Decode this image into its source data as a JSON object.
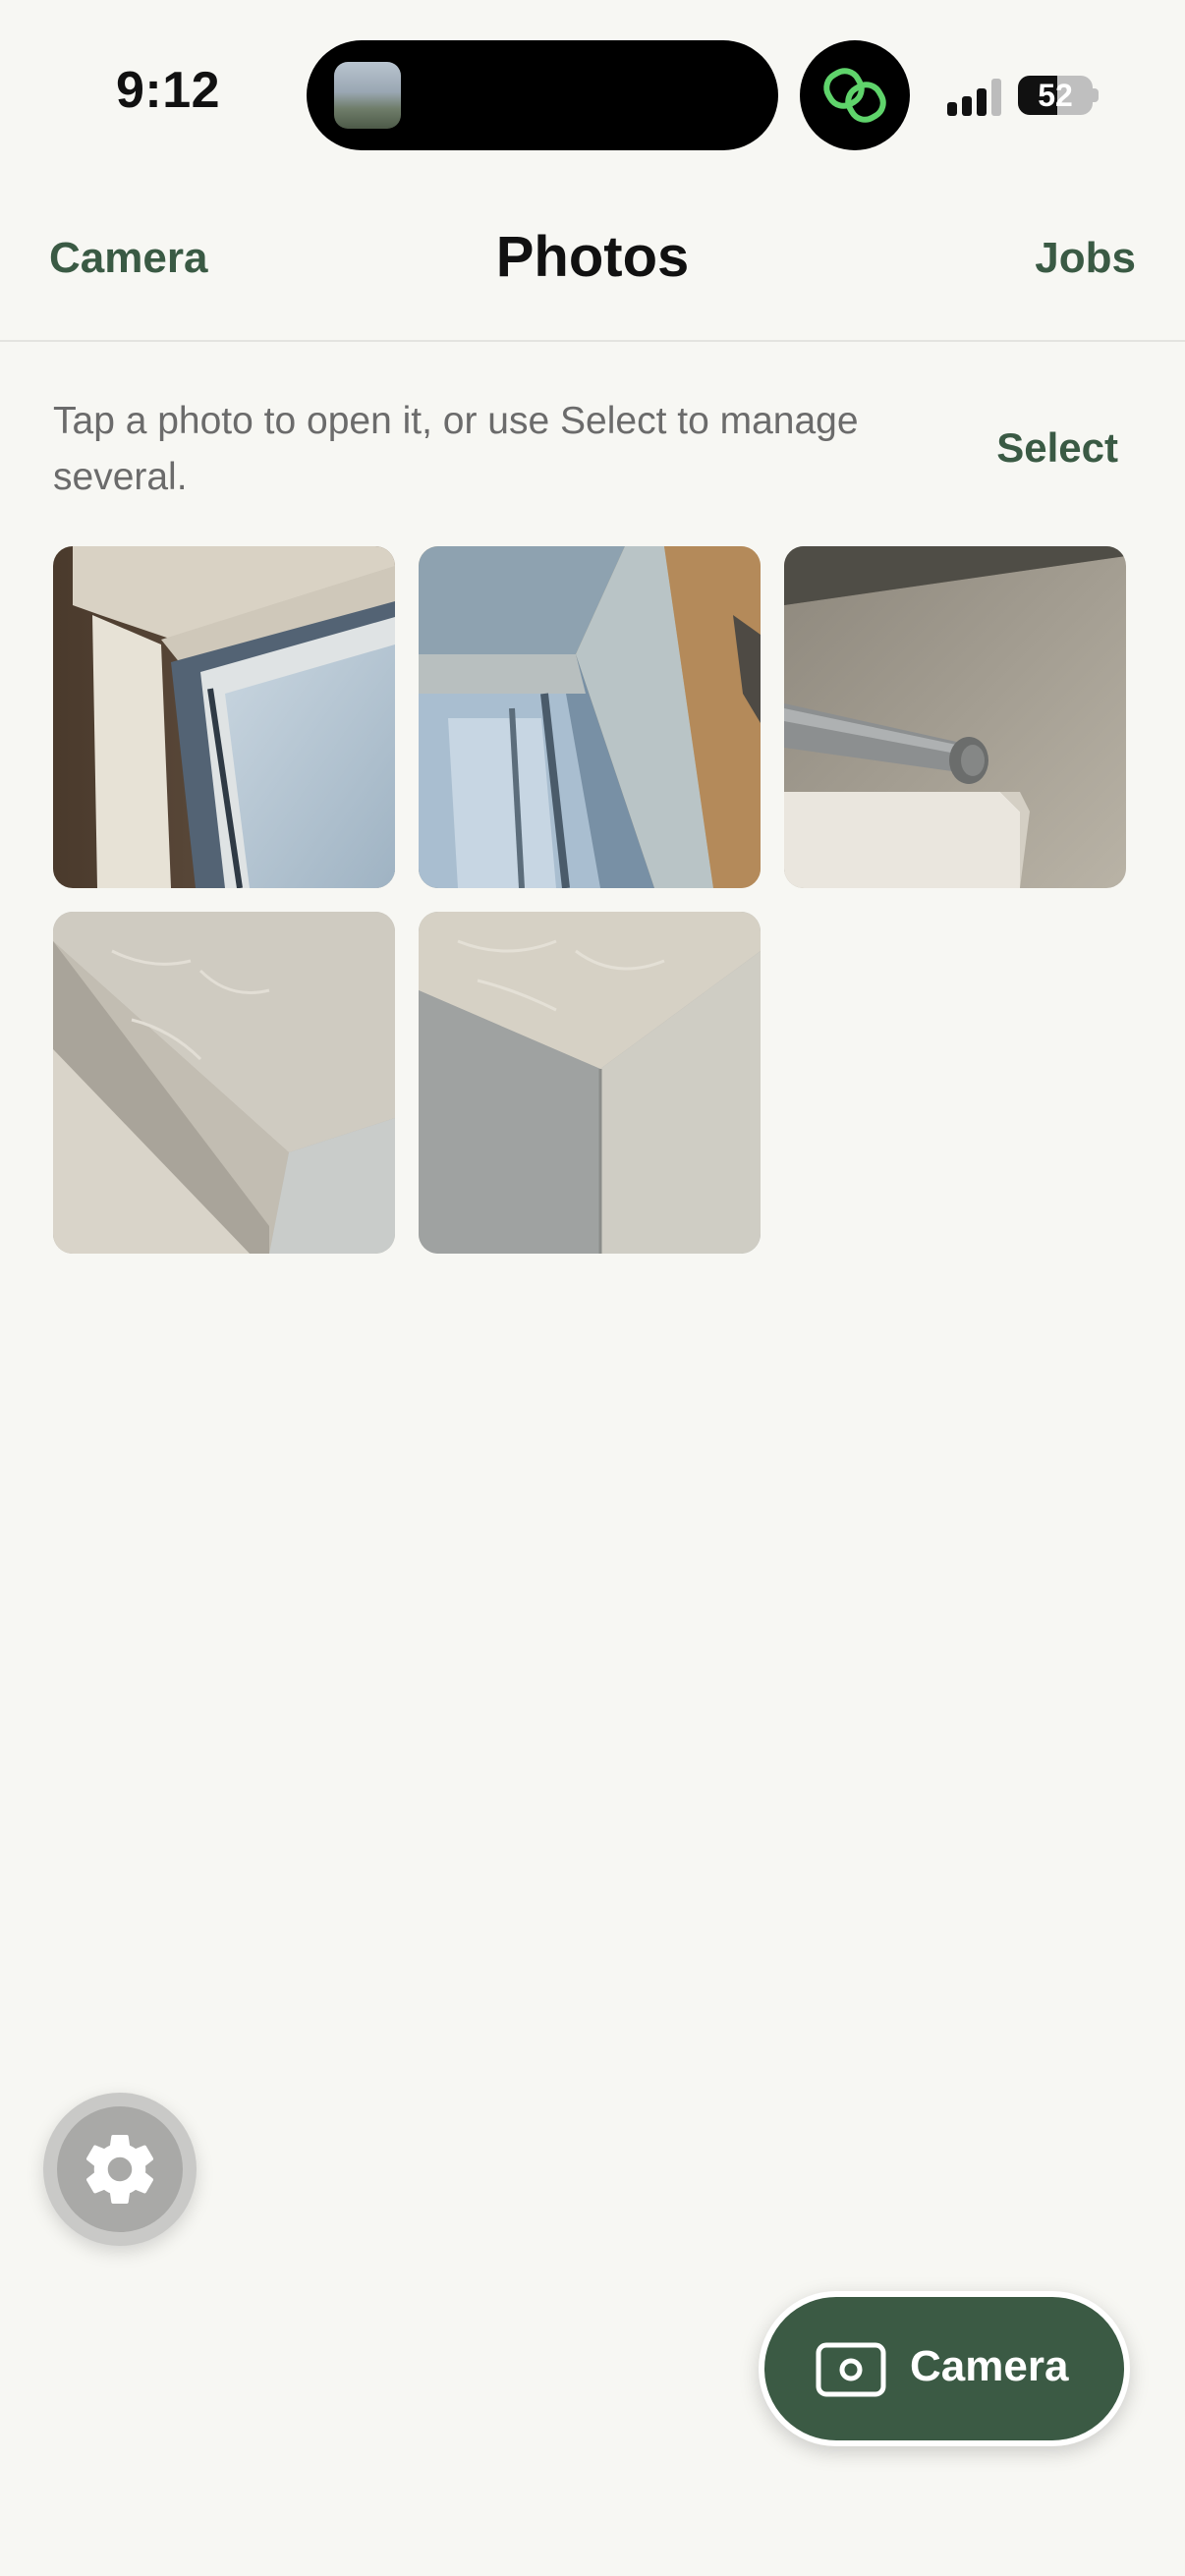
{
  "status_bar": {
    "time": "9:12",
    "battery_percent": "52",
    "battery_level": 0.52,
    "signal_bars_active": 3
  },
  "nav": {
    "left_label": "Camera",
    "title": "Photos",
    "right_label": "Jobs"
  },
  "hint": {
    "text": "Tap a photo to open it, or use Select to manage several.",
    "select_label": "Select"
  },
  "photos": [
    {
      "subject": "window-frame-corner"
    },
    {
      "subject": "window-recess"
    },
    {
      "subject": "pipe-through-wall"
    },
    {
      "subject": "ceiling-corner"
    },
    {
      "subject": "wall-ceiling-corner"
    }
  ],
  "fab": {
    "camera_label": "Camera",
    "camera_icon": "camera-icon",
    "settings_icon": "gear-icon"
  },
  "colors": {
    "accent": "#3b5a44",
    "background": "#f7f7f3",
    "island_icon": "#5fd36b"
  }
}
